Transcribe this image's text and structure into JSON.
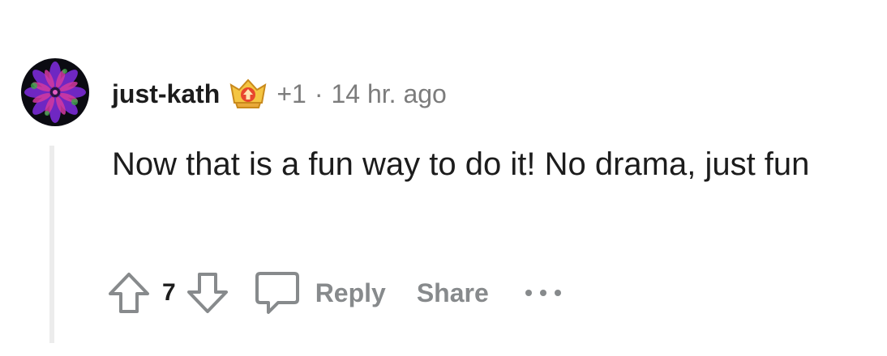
{
  "comment": {
    "username": "just-kath",
    "flair_icon": "achievement-badge-icon",
    "score_delta": "+1",
    "separator": "·",
    "timestamp": "14 hr. ago",
    "body": "Now that is a fun way to do it! No drama, just fun"
  },
  "actions": {
    "upvote_icon": "arrow-up-icon",
    "vote_count": "7",
    "downvote_icon": "arrow-down-icon",
    "reply_icon": "speech-bubble-icon",
    "reply_label": "Reply",
    "share_label": "Share",
    "more_icon": "ellipsis-icon"
  },
  "colors": {
    "text_primary": "#1c1c1c",
    "text_secondary": "#7c7c7c",
    "action_gray": "#878a8c",
    "thread_line": "#ececec"
  }
}
